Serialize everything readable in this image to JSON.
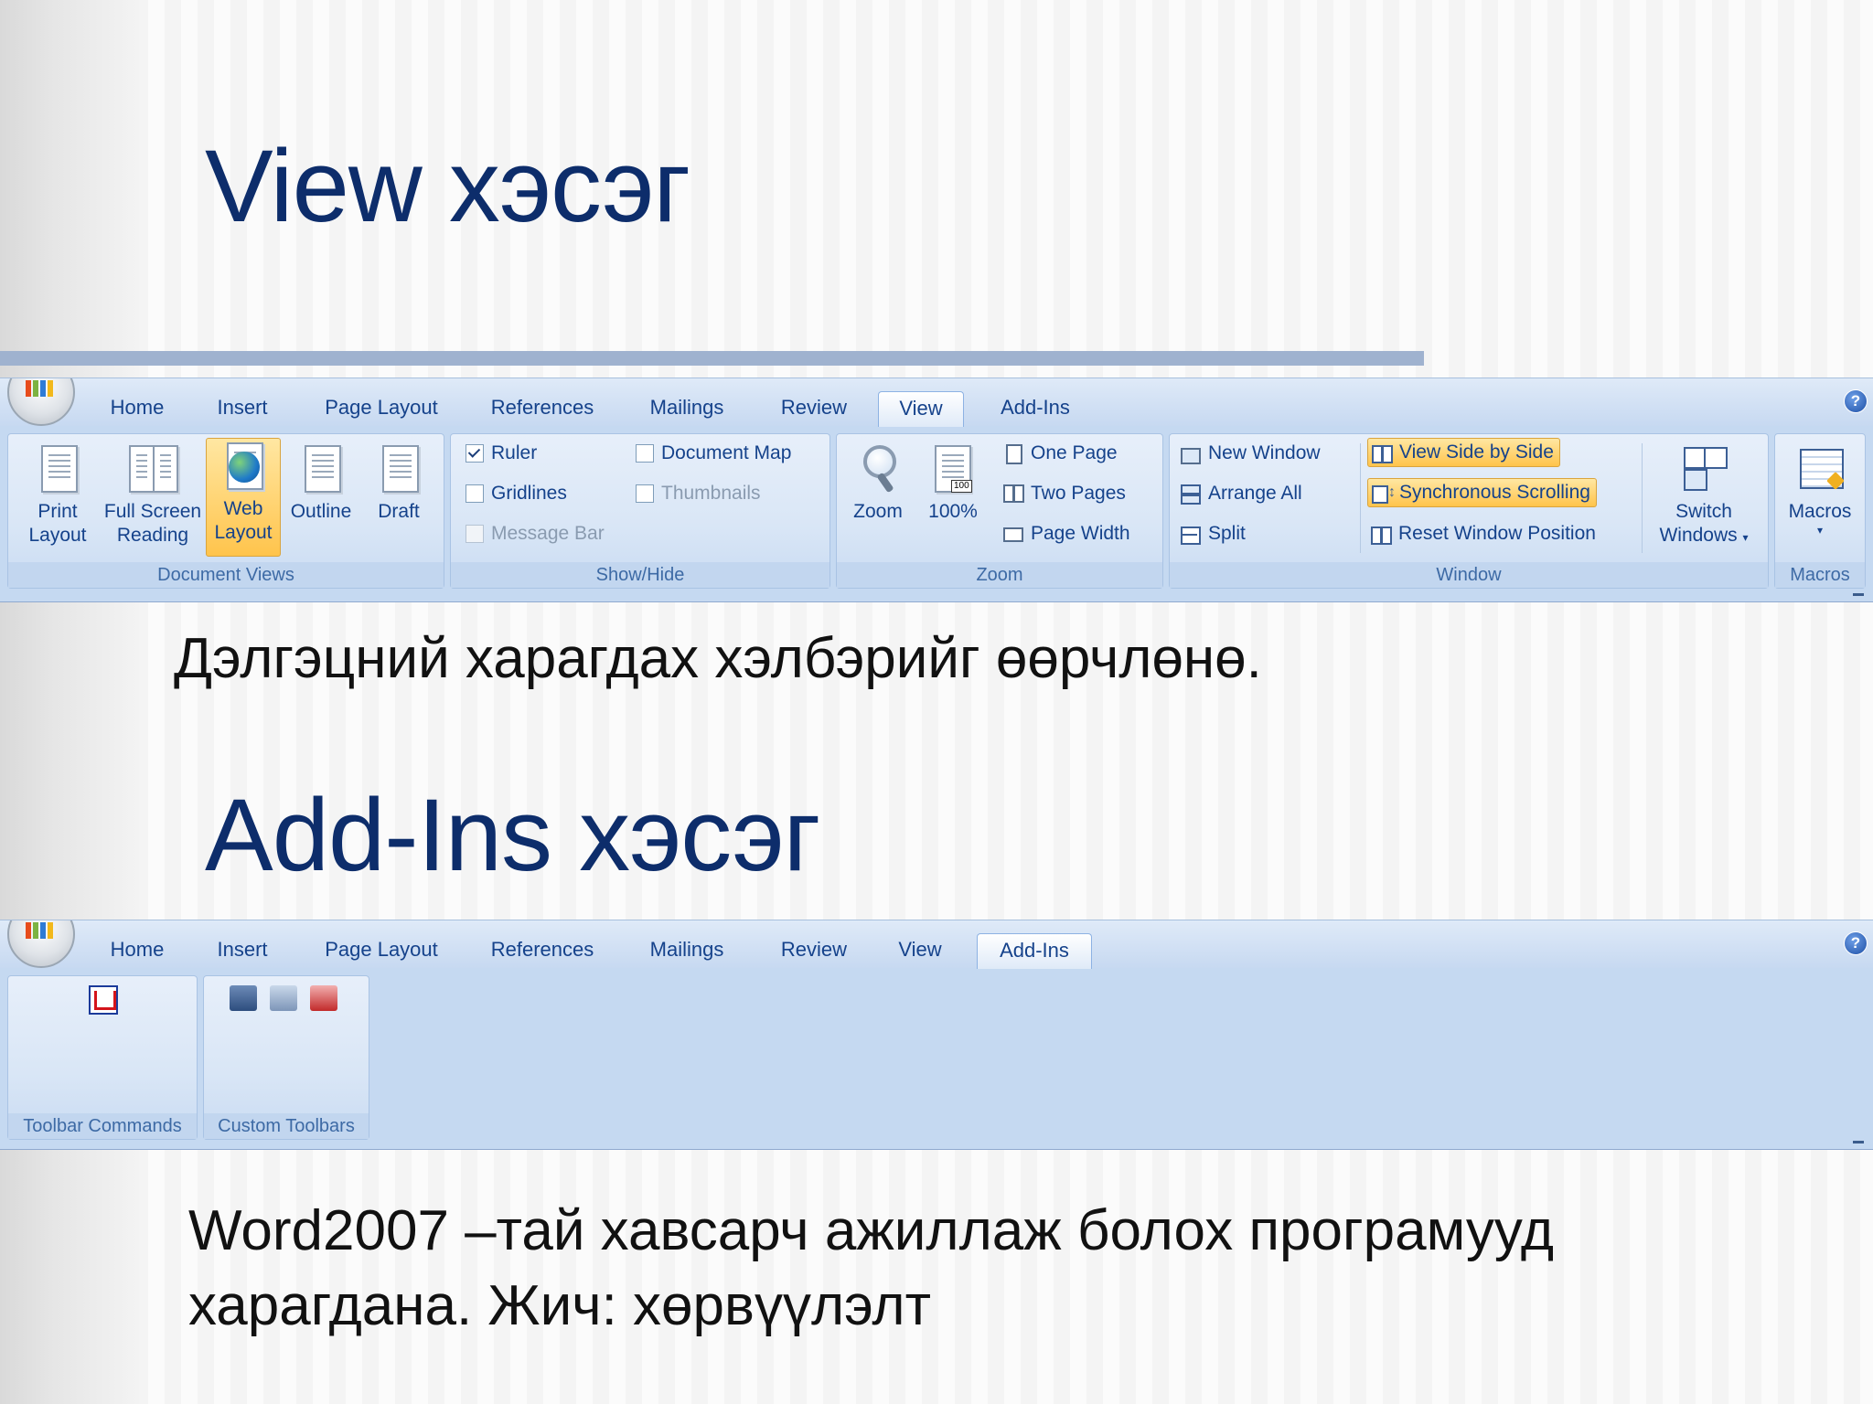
{
  "slide": {
    "title_view": "View хэсэг",
    "desc_view": "Дэлгэцний харагдах хэлбэрийг өөрчлөнө.",
    "title_addins": "Add-Ins хэсэг",
    "desc_addins_line1": "Word2007 –тай хавсарч ажиллаж болох програмууд",
    "desc_addins_line2": "харагдана. Жич: хөрвүүлэлт"
  },
  "ribbon_view": {
    "tabs": [
      "Home",
      "Insert",
      "Page Layout",
      "References",
      "Mailings",
      "Review",
      "View",
      "Add-Ins"
    ],
    "active_tab": "View",
    "document_views": {
      "label": "Document Views",
      "print_layout": [
        "Print",
        "Layout"
      ],
      "full_screen_reading": [
        "Full Screen",
        "Reading"
      ],
      "web_layout": [
        "Web",
        "Layout"
      ],
      "outline": "Outline",
      "draft": "Draft"
    },
    "show_hide": {
      "label": "Show/Hide",
      "ruler": "Ruler",
      "gridlines": "Gridlines",
      "message_bar": "Message Bar",
      "document_map": "Document Map",
      "thumbnails": "Thumbnails"
    },
    "zoom": {
      "label": "Zoom",
      "zoom": "Zoom",
      "hundred": "100%",
      "icon_badge": "100",
      "one_page": "One Page",
      "two_pages": "Two Pages",
      "page_width": "Page Width"
    },
    "window": {
      "label": "Window",
      "new_window": "New Window",
      "arrange_all": "Arrange All",
      "split": "Split",
      "view_side_by_side": "View Side by Side",
      "synchronous_scrolling": "Synchronous Scrolling",
      "reset_window_position": "Reset Window Position",
      "switch_windows": [
        "Switch",
        "Windows"
      ]
    },
    "macros": {
      "label": "Macros",
      "macros": "Macros"
    }
  },
  "ribbon_addins": {
    "tabs": [
      "Home",
      "Insert",
      "Page Layout",
      "References",
      "Mailings",
      "Review",
      "View",
      "Add-Ins"
    ],
    "active_tab": "Add-Ins",
    "toolbar_commands": "Toolbar Commands",
    "custom_toolbars": "Custom Toolbars"
  },
  "colors": {
    "title": "#0d2d6b",
    "ribbon_bg": "#c5d9f1",
    "ribbon_text": "#15428b",
    "highlight": "#ffc44c"
  }
}
